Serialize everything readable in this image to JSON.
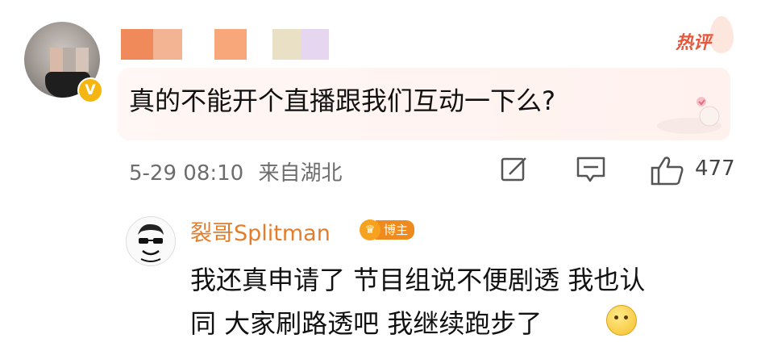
{
  "comment": {
    "hot_label": "热评",
    "text": "真的不能开个直播跟我们互动一下么?",
    "date": "5-29 08:10",
    "location": "来自湖北",
    "like_count": "477",
    "icons": [
      "share-icon",
      "comment-icon",
      "like-icon"
    ],
    "verified_badge_glyph": "V",
    "name_mosaic_colors": [
      "#f08a5b",
      "#f2b492",
      "#ffffff",
      "#f7a77a",
      "#ffffff",
      "#e9e0c6",
      "#e6d6f0"
    ]
  },
  "reply": {
    "author": "裂哥Splitman",
    "badge_label": "博主",
    "lines": [
      "我还真申请了 节目组说不便剧透 我也认",
      "同 大家刷路透吧 我继续跑步了"
    ],
    "emoji": "smirk-emoji"
  },
  "colors": {
    "hot_red": "#e6573c",
    "author_orange": "#e47d2b",
    "badge_orange": "#ef8a1f",
    "meta_gray": "#6d6d6d"
  }
}
